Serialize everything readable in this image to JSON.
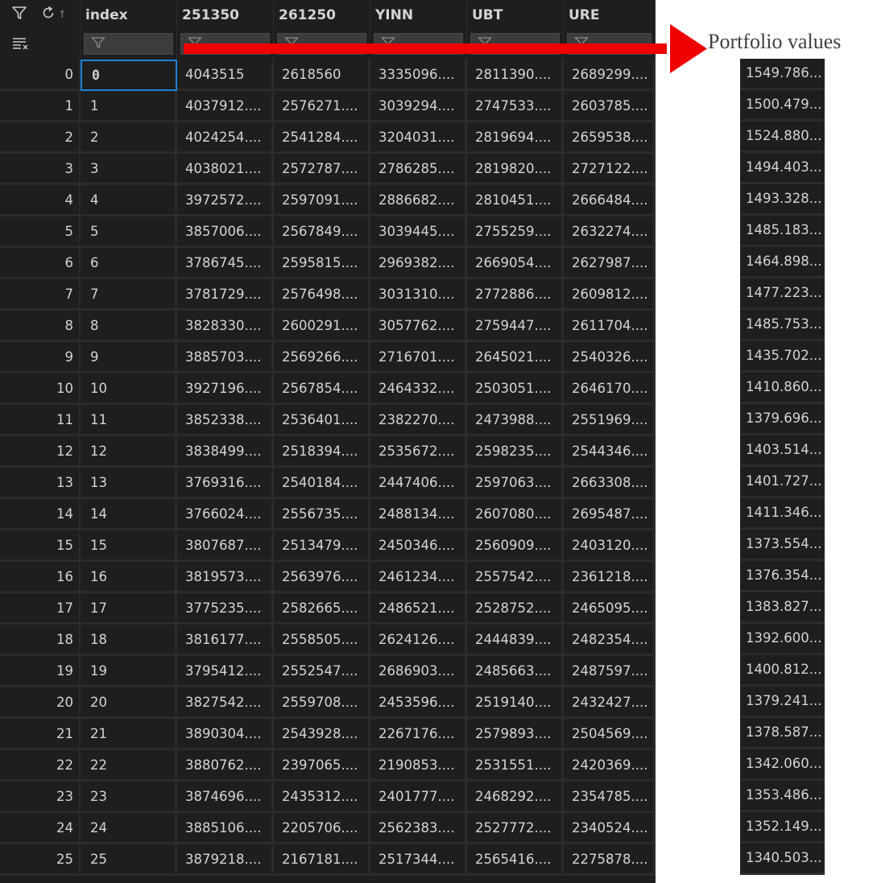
{
  "table": {
    "columns": [
      "index",
      "251350",
      "261250",
      "YINN",
      "UBT",
      "URE"
    ],
    "rows": [
      {
        "rownum": "0",
        "index": "0",
        "c251350": "4043515",
        "c261250": "2618560",
        "YINN": "3335096....",
        "UBT": "2811390....",
        "URE": "2689299...."
      },
      {
        "rownum": "1",
        "index": "1",
        "c251350": "4037912....",
        "c261250": "2576271....",
        "YINN": "3039294....",
        "UBT": "2747533....",
        "URE": "2603785...."
      },
      {
        "rownum": "2",
        "index": "2",
        "c251350": "4024254....",
        "c261250": "2541284....",
        "YINN": "3204031....",
        "UBT": "2819694....",
        "URE": "2659538...."
      },
      {
        "rownum": "3",
        "index": "3",
        "c251350": "4038021....",
        "c261250": "2572787....",
        "YINN": "2786285....",
        "UBT": "2819820....",
        "URE": "2727122...."
      },
      {
        "rownum": "4",
        "index": "4",
        "c251350": "3972572....",
        "c261250": "2597091....",
        "YINN": "2886682....",
        "UBT": "2810451....",
        "URE": "2666484...."
      },
      {
        "rownum": "5",
        "index": "5",
        "c251350": "3857006....",
        "c261250": "2567849....",
        "YINN": "3039445....",
        "UBT": "2755259....",
        "URE": "2632274...."
      },
      {
        "rownum": "6",
        "index": "6",
        "c251350": "3786745....",
        "c261250": "2595815....",
        "YINN": "2969382....",
        "UBT": "2669054....",
        "URE": "2627987...."
      },
      {
        "rownum": "7",
        "index": "7",
        "c251350": "3781729....",
        "c261250": "2576498....",
        "YINN": "3031310....",
        "UBT": "2772886....",
        "URE": "2609812...."
      },
      {
        "rownum": "8",
        "index": "8",
        "c251350": "3828330....",
        "c261250": "2600291....",
        "YINN": "3057762....",
        "UBT": "2759447....",
        "URE": "2611704...."
      },
      {
        "rownum": "9",
        "index": "9",
        "c251350": "3885703....",
        "c261250": "2569266....",
        "YINN": "2716701....",
        "UBT": "2645021....",
        "URE": "2540326...."
      },
      {
        "rownum": "10",
        "index": "10",
        "c251350": "3927196....",
        "c261250": "2567854....",
        "YINN": "2464332....",
        "UBT": "2503051....",
        "URE": "2646170...."
      },
      {
        "rownum": "11",
        "index": "11",
        "c251350": "3852338....",
        "c261250": "2536401....",
        "YINN": "2382270....",
        "UBT": "2473988....",
        "URE": "2551969...."
      },
      {
        "rownum": "12",
        "index": "12",
        "c251350": "3838499....",
        "c261250": "2518394....",
        "YINN": "2535672....",
        "UBT": "2598235....",
        "URE": "2544346...."
      },
      {
        "rownum": "13",
        "index": "13",
        "c251350": "3769316....",
        "c261250": "2540184....",
        "YINN": "2447406....",
        "UBT": "2597063....",
        "URE": "2663308...."
      },
      {
        "rownum": "14",
        "index": "14",
        "c251350": "3766024....",
        "c261250": "2556735....",
        "YINN": "2488134....",
        "UBT": "2607080....",
        "URE": "2695487...."
      },
      {
        "rownum": "15",
        "index": "15",
        "c251350": "3807687....",
        "c261250": "2513479....",
        "YINN": "2450346....",
        "UBT": "2560909....",
        "URE": "2403120...."
      },
      {
        "rownum": "16",
        "index": "16",
        "c251350": "3819573....",
        "c261250": "2563976....",
        "YINN": "2461234....",
        "UBT": "2557542....",
        "URE": "2361218...."
      },
      {
        "rownum": "17",
        "index": "17",
        "c251350": "3775235....",
        "c261250": "2582665....",
        "YINN": "2486521....",
        "UBT": "2528752....",
        "URE": "2465095...."
      },
      {
        "rownum": "18",
        "index": "18",
        "c251350": "3816177....",
        "c261250": "2558505....",
        "YINN": "2624126....",
        "UBT": "2444839....",
        "URE": "2482354...."
      },
      {
        "rownum": "19",
        "index": "19",
        "c251350": "3795412....",
        "c261250": "2552547....",
        "YINN": "2686903....",
        "UBT": "2485663....",
        "URE": "2487597...."
      },
      {
        "rownum": "20",
        "index": "20",
        "c251350": "3827542....",
        "c261250": "2559708....",
        "YINN": "2453596....",
        "UBT": "2519140....",
        "URE": "2432427...."
      },
      {
        "rownum": "21",
        "index": "21",
        "c251350": "3890304....",
        "c261250": "2543928....",
        "YINN": "2267176....",
        "UBT": "2579893....",
        "URE": "2504569...."
      },
      {
        "rownum": "22",
        "index": "22",
        "c251350": "3880762....",
        "c261250": "2397065....",
        "YINN": "2190853....",
        "UBT": "2531551....",
        "URE": "2420369...."
      },
      {
        "rownum": "23",
        "index": "23",
        "c251350": "3874696....",
        "c261250": "2435312....",
        "YINN": "2401777....",
        "UBT": "2468292....",
        "URE": "2354785...."
      },
      {
        "rownum": "24",
        "index": "24",
        "c251350": "3885106....",
        "c261250": "2205706....",
        "YINN": "2562383....",
        "UBT": "2527772....",
        "URE": "2340524...."
      },
      {
        "rownum": "25",
        "index": "25",
        "c251350": "3879218....",
        "c261250": "2167181....",
        "YINN": "2517344....",
        "UBT": "2565416....",
        "URE": "2275878...."
      }
    ],
    "selected_cell": {
      "row": 0,
      "column": "index"
    }
  },
  "annotation": {
    "label": "Portfolio values",
    "arrow_color": "#ee0000"
  },
  "portfolio_values": [
    "1549.786...",
    "1500.479...",
    "1524.880...",
    "1494.403...",
    "1493.328...",
    "1485.183...",
    "1464.898...",
    "1477.223...",
    "1485.753...",
    "1435.702...",
    "1410.860...",
    "1379.696...",
    "1403.514...",
    "1401.727...",
    "1411.346...",
    "1373.554...",
    "1376.354...",
    "1383.827...",
    "1392.600...",
    "1400.812...",
    "1379.241...",
    "1378.587...",
    "1342.060...",
    "1353.486...",
    "1352.149...",
    "1340.503..."
  ],
  "icons": {
    "filter": "filter-icon",
    "refresh": "refresh-icon",
    "sort": "sort-up-icon",
    "clear_filters": "clear-filters-icon"
  },
  "colors": {
    "background": "#1e1e1e",
    "grid_line": "#2b2b2b",
    "text": "#d4d4d4",
    "filter_box": "#3c3c3c",
    "selection": "#1e81d6",
    "arrow": "#ee0000"
  }
}
